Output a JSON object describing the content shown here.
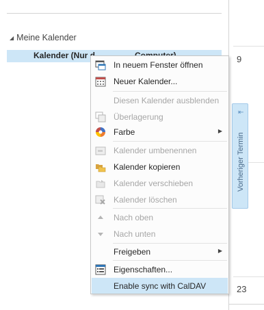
{
  "nav": {
    "group_label": "Meine Kalender",
    "calendar_label": "Kalender (Nur d",
    "calendar_label_tail": "Computer)"
  },
  "grid": {
    "day_top": "9",
    "day_bottom": "23"
  },
  "prev_tab": {
    "label": "Vorheriger Termin"
  },
  "menu": {
    "open_new_window": "In neuem Fenster öffnen",
    "new_calendar": "Neuer Kalender...",
    "hide_calendar": "Diesen Kalender ausblenden",
    "overlay": "Überlagerung",
    "color": "Farbe",
    "rename": "Kalender umbenennen",
    "copy": "Kalender kopieren",
    "move": "Kalender verschieben",
    "delete": "Kalender löschen",
    "move_up": "Nach oben",
    "move_down": "Nach unten",
    "share": "Freigeben",
    "properties": "Eigenschaften...",
    "caldav": "Enable sync with CalDAV"
  },
  "colors": {
    "highlight": "#cde6f7",
    "accent": "#2e75b6"
  }
}
